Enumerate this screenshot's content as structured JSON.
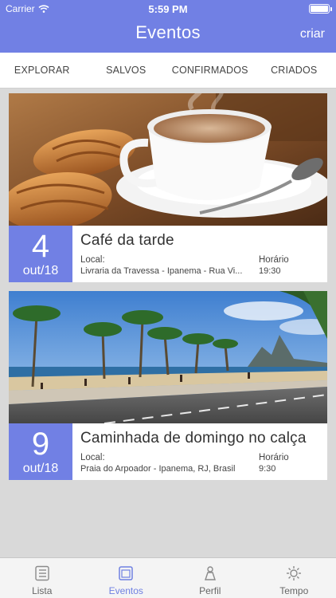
{
  "status_bar": {
    "carrier": "Carrier",
    "time": "5:59 PM"
  },
  "header": {
    "title": "Eventos",
    "create_label": "criar"
  },
  "tabs": [
    {
      "label": "EXPLORAR"
    },
    {
      "label": "SALVOS"
    },
    {
      "label": "CONFIRMADOS"
    },
    {
      "label": "CRIADOS"
    }
  ],
  "events": [
    {
      "day": "4",
      "month": "out/18",
      "title": "Café da tarde",
      "local_label": "Local:",
      "local": "Livraria da Travessa - Ipanema - Rua Vi...",
      "time_label": "Horário",
      "time": "19:30",
      "image": "coffee-croissant-photo"
    },
    {
      "day": "9",
      "month": "out/18",
      "title": "Caminhada de domingo no calça",
      "local_label": "Local:",
      "local": "Praia do Arpoador - Ipanema, RJ, Brasil",
      "time_label": "Horário",
      "time": "9:30",
      "image": "beach-promenade-photo"
    }
  ],
  "bottom_tabs": [
    {
      "label": "Lista",
      "icon": "list-icon",
      "active": false
    },
    {
      "label": "Eventos",
      "icon": "calendar-icon",
      "active": true
    },
    {
      "label": "Perfil",
      "icon": "profile-icon",
      "active": false
    },
    {
      "label": "Tempo",
      "icon": "sun-icon",
      "active": false
    }
  ],
  "colors": {
    "accent": "#7180e4",
    "background": "#d9d9d9"
  }
}
